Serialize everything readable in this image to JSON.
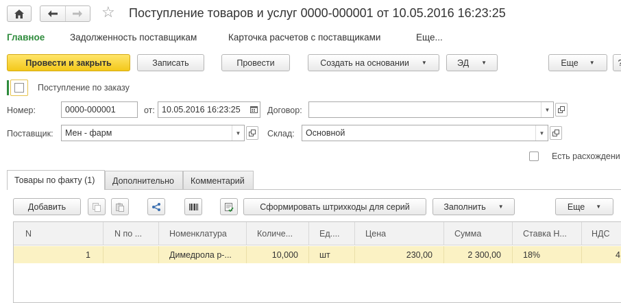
{
  "window": {
    "title": "Поступление товаров и услуг 0000-000001 от 10.05.2016 16:23:25",
    "home_icon": "home-icon",
    "back_icon": "arrow-left-icon",
    "forward_icon": "arrow-right-icon",
    "favorite_icon": "star-icon"
  },
  "sections": [
    "Главное",
    "Задолженность поставщикам",
    "Карточка расчетов с поставщиками",
    "Еще..."
  ],
  "toolbar": {
    "post_close": "Провести и закрыть",
    "save": "Записать",
    "post": "Провести",
    "create_based": "Создать на основании",
    "ed": "ЭД",
    "more": "Еще",
    "help": "?"
  },
  "form": {
    "by_order_label": "Поступление по заказу",
    "number_label": "Номер:",
    "number_value": "0000-000001",
    "date_label": "от:",
    "date_value": "10.05.2016 16:23:25",
    "contract_label": "Договор:",
    "contract_value": "",
    "supplier_label": "Поставщик:",
    "supplier_value": "Мен - фарм",
    "warehouse_label": "Склад:",
    "warehouse_value": "Основной",
    "discrepancies_label": "Есть расхождени"
  },
  "tabs": [
    "Товары по факту (1)",
    "Дополнительно",
    "Комментарий"
  ],
  "table_toolbar": {
    "add": "Добавить",
    "generate_barcodes": "Сформировать штрихкоды для серий",
    "fill": "Заполнить",
    "more": "Еще"
  },
  "table": {
    "columns": [
      "N",
      "N по ...",
      "Номенклатура",
      "Количе...",
      "Ед....",
      "Цена",
      "Сумма",
      "Ставка Н...",
      "НДС"
    ],
    "rows": [
      [
        "1",
        "",
        "Димедрола р-...",
        "10,000",
        "шт",
        "230,00",
        "2 300,00",
        "18%",
        "4"
      ]
    ]
  },
  "colors": {
    "accent_green": "#2e8b3c",
    "primary_yellow": "#f3c81a",
    "selected_row": "#fbf2c4"
  }
}
